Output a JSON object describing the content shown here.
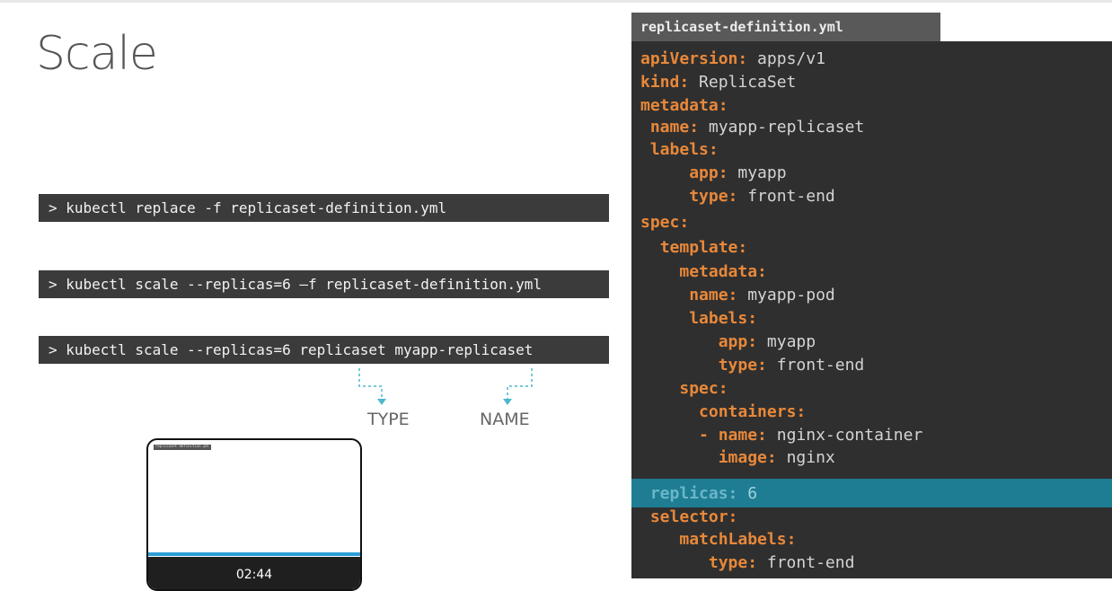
{
  "slide": {
    "title": "Scale"
  },
  "commands": [
    "> kubectl replace -f replicaset-definition.yml",
    "> kubectl scale --replicas=6 –f replicaset-definition.yml",
    "> kubectl scale --replicas=6 replicaset myapp-replicaset"
  ],
  "annotations": {
    "type": "TYPE",
    "name": "NAME"
  },
  "file": {
    "name": "replicaset-definition.yml"
  },
  "yaml": [
    {
      "indent": "",
      "key": "apiVersion:",
      "value": " apps/v1"
    },
    {
      "indent": "",
      "key": "kind:",
      "value": " ReplicaSet"
    },
    {
      "indent": "",
      "key": "metadata:",
      "value": ""
    },
    {
      "indent": " ",
      "key": "name:",
      "value": " myapp-replicaset"
    },
    {
      "indent": " ",
      "key": "labels:",
      "value": ""
    },
    {
      "indent": "     ",
      "key": "app:",
      "value": " myapp"
    },
    {
      "indent": "     ",
      "key": "type:",
      "value": " front-end"
    },
    {
      "indent": "",
      "key": "spec:",
      "value": ""
    },
    {
      "indent": "  ",
      "key": "template:",
      "value": ""
    },
    {
      "indent": "    ",
      "key": "metadata:",
      "value": ""
    },
    {
      "indent": "     ",
      "key": "name:",
      "value": " myapp-pod"
    },
    {
      "indent": "     ",
      "key": "labels:",
      "value": ""
    },
    {
      "indent": "        ",
      "key": "app:",
      "value": " myapp"
    },
    {
      "indent": "        ",
      "key": "type:",
      "value": " front-end"
    },
    {
      "indent": "    ",
      "key": "spec:",
      "value": ""
    },
    {
      "indent": "      ",
      "key": "containers:",
      "value": ""
    },
    {
      "indent": "      ",
      "key": "- name:",
      "value": " nginx-container"
    },
    {
      "indent": "        ",
      "key": "image:",
      "value": " nginx"
    },
    {
      "indent": " ",
      "key": "replicas:",
      "value": " 6",
      "highlight": true
    },
    {
      "indent": " ",
      "key": "selector:",
      "value": ""
    },
    {
      "indent": "    ",
      "key": "matchLabels:",
      "value": ""
    },
    {
      "indent": "       ",
      "key": "type:",
      "value": " front-end"
    }
  ],
  "video": {
    "timestamp": "02:44",
    "thumb_label": "replicaset-definition.yml"
  },
  "colors": {
    "yaml_key": "#e8883a",
    "yaml_value": "#d4d4d4",
    "highlight": "#1e7d93",
    "command_bg": "#3b3b3b",
    "arrow": "#4bb8cc"
  }
}
